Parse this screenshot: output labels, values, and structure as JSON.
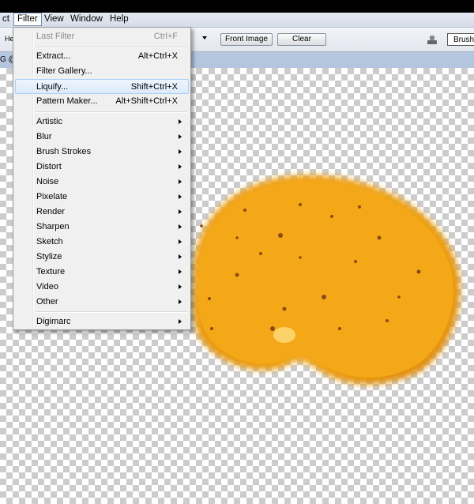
{
  "menubar": {
    "items": [
      {
        "label": "ct"
      },
      {
        "label": "Filter"
      },
      {
        "label": "View"
      },
      {
        "label": "Window"
      },
      {
        "label": "Help"
      }
    ]
  },
  "options_bar": {
    "left_label": "He",
    "front_image_label": "Front Image",
    "clear_label": "Clear",
    "brushes_label": "Brushe"
  },
  "document": {
    "tab_label": "G @"
  },
  "filter_menu": {
    "last_filter": {
      "label": "Last Filter",
      "shortcut": "Ctrl+F"
    },
    "extract": {
      "label": "Extract...",
      "shortcut": "Alt+Ctrl+X"
    },
    "filter_gallery": {
      "label": "Filter Gallery..."
    },
    "liquify": {
      "label": "Liquify...",
      "shortcut": "Shift+Ctrl+X"
    },
    "pattern_maker": {
      "label": "Pattern Maker...",
      "shortcut": "Alt+Shift+Ctrl+X"
    },
    "submenus": [
      "Artistic",
      "Blur",
      "Brush Strokes",
      "Distort",
      "Noise",
      "Pixelate",
      "Render",
      "Sharpen",
      "Sketch",
      "Stylize",
      "Texture",
      "Video",
      "Other"
    ],
    "digimarc": {
      "label": "Digimarc"
    }
  },
  "colors": {
    "blob": "#f2a818",
    "highlight": "#dcebfb"
  }
}
